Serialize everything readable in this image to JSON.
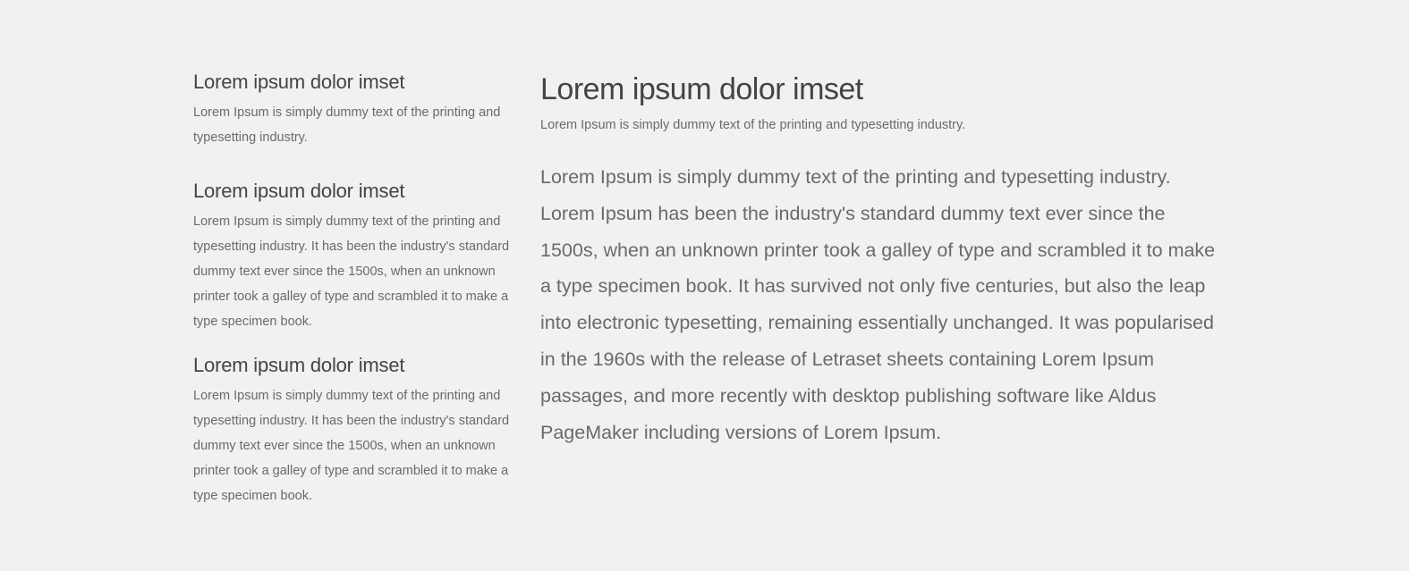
{
  "sidebar": {
    "items": [
      {
        "title": "Lorem ipsum dolor imset",
        "text": "Lorem Ipsum is simply dummy text of the printing and typesetting industry."
      },
      {
        "title": "Lorem ipsum dolor imset",
        "text": "Lorem Ipsum is simply dummy text of the printing and typesetting industry. It has been the industry's standard dummy text ever since the 1500s, when an unknown printer took a galley of type and scrambled it to make a type specimen book."
      },
      {
        "title": "Lorem ipsum dolor imset",
        "text": "Lorem Ipsum is simply dummy text of the printing and typesetting industry. It has been the industry's standard dummy text ever since the 1500s, when an unknown printer took a galley of type and scrambled it to make a type specimen book."
      }
    ]
  },
  "main": {
    "title": "Lorem ipsum dolor imset",
    "subtitle": "Lorem Ipsum is simply dummy text of the printing and typesetting industry.",
    "body": "Lorem Ipsum is simply dummy text of the printing and typesetting industry. Lorem Ipsum has been the industry's standard dummy text ever since the 1500s, when an unknown printer took a galley of type and scrambled it to make a type specimen book. It has survived not only five centuries, but also the leap into electronic typesetting, remaining essentially unchanged. It was popularised in the 1960s with the release of Letraset sheets containing Lorem Ipsum passages, and more recently with desktop publishing software like Aldus PageMaker including versions of Lorem Ipsum."
  },
  "colors": {
    "background": "#f1f1f1",
    "heading": "#444444",
    "text": "#6a6a6a"
  }
}
